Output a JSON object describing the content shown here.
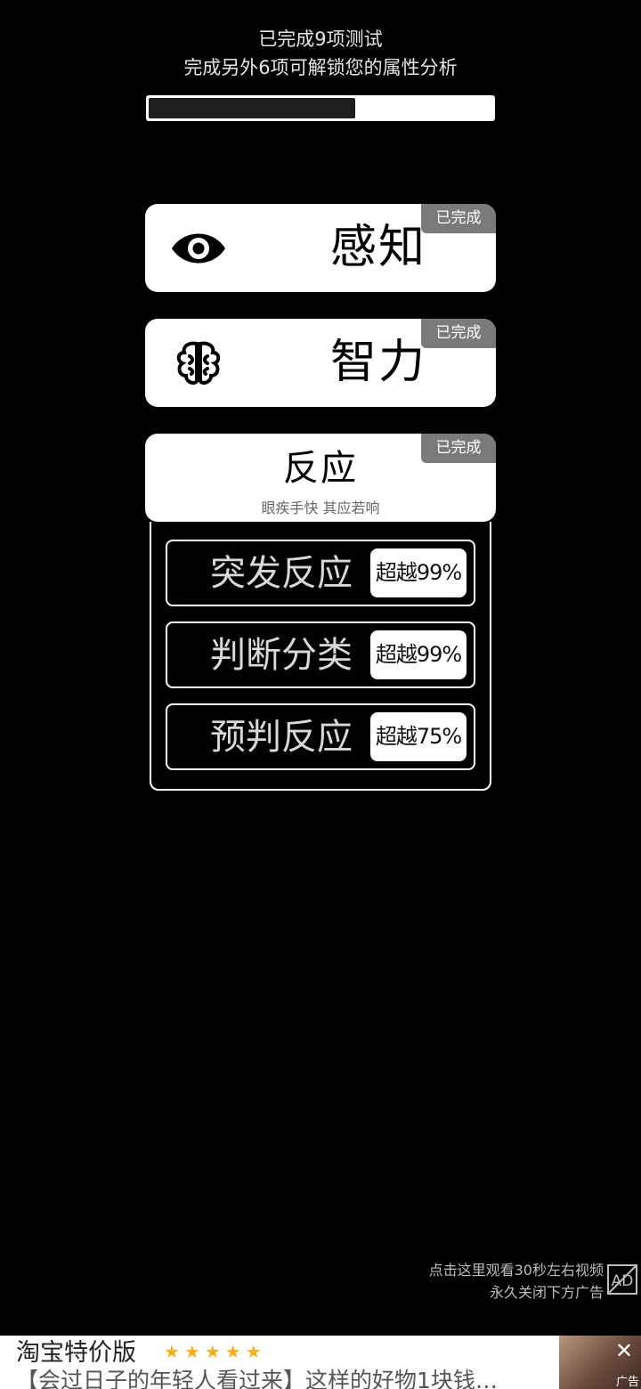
{
  "header": {
    "line1": "已完成9项测试",
    "line2": "完成另外6项可解锁您的属性分析",
    "progress_percent": 60
  },
  "cards": [
    {
      "title": "感知",
      "badge": "已完成",
      "icon": "eye-icon"
    },
    {
      "title": "智力",
      "badge": "已完成",
      "icon": "brain-icon"
    },
    {
      "title": "反应",
      "badge": "已完成",
      "subtitle": "眼疾手快 其应若响"
    }
  ],
  "reaction_tests": [
    {
      "label": "突发反应",
      "score": "超越99%"
    },
    {
      "label": "判断分类",
      "score": "超越99%"
    },
    {
      "label": "预判反应",
      "score": "超越75%"
    }
  ],
  "ad": {
    "hint_line1": "点击这里观看30秒左右视频",
    "hint_line2": "永久关闭下方广告",
    "mark": "AD"
  },
  "banner": {
    "brand": "淘宝特价版",
    "stars": "★★★★★",
    "rating": 5,
    "desc": "【会过日子的年轻人看过来】这样的好物1块钱…",
    "close": "✕",
    "tag": "广告"
  },
  "colors": {
    "background": "#000000",
    "card": "#ffffff",
    "badge": "#7a7a7a",
    "star": "#f2b01e"
  }
}
